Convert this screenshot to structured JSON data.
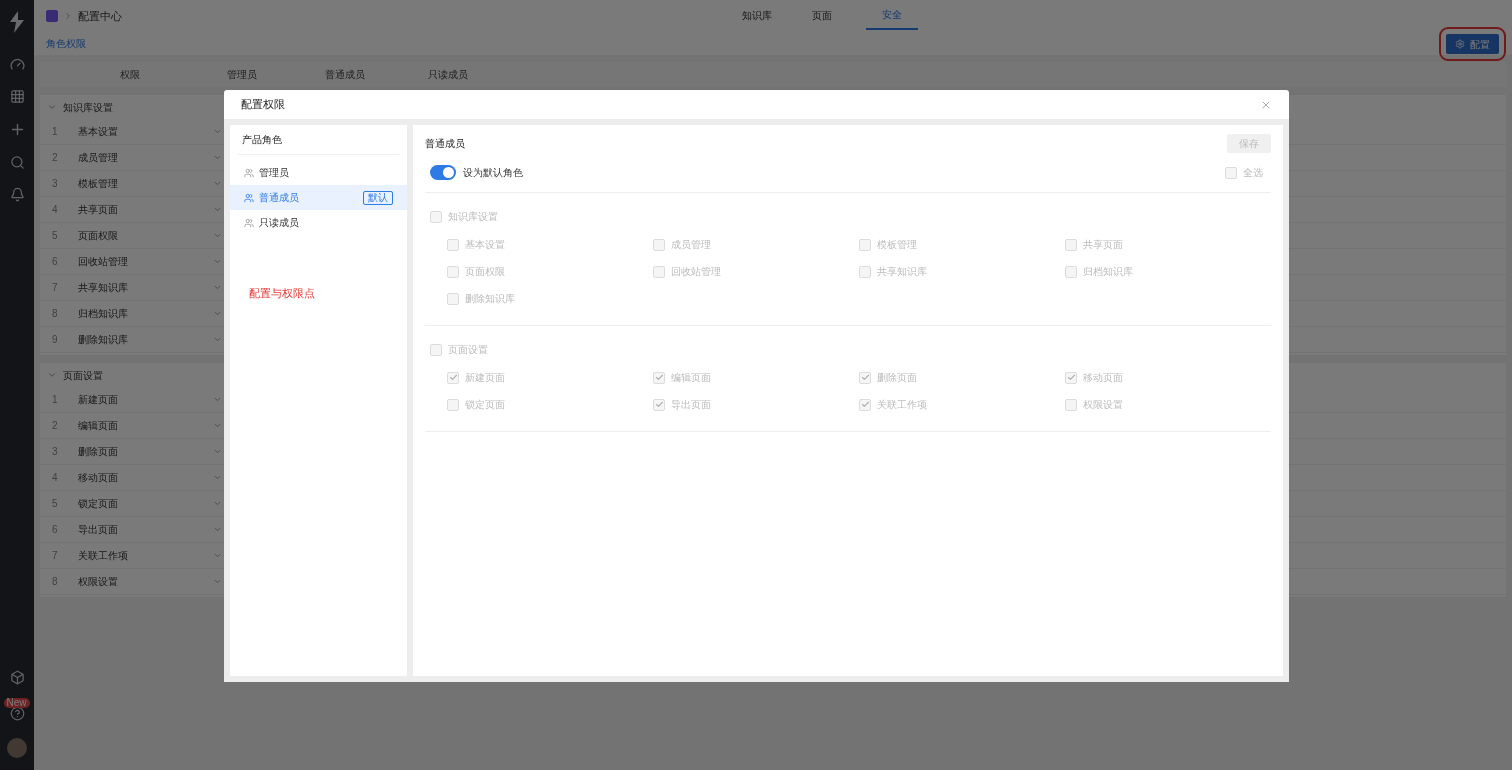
{
  "header": {
    "breadcrumb": "配置中心",
    "tabs": [
      {
        "label": "知识库",
        "selected": false
      },
      {
        "label": "页面",
        "selected": false
      },
      {
        "label": "安全",
        "selected": true
      }
    ],
    "sub_tab": "角色权限",
    "config_button": "配置"
  },
  "sidebar": {
    "badge": "New"
  },
  "table": {
    "columns": [
      "权限",
      "管理员",
      "普通成员",
      "只读成员"
    ],
    "groups": [
      {
        "title": "知识库设置",
        "expanded": true,
        "rows": [
          {
            "index": "1",
            "name": "基本设置"
          },
          {
            "index": "2",
            "name": "成员管理"
          },
          {
            "index": "3",
            "name": "模板管理"
          },
          {
            "index": "4",
            "name": "共享页面"
          },
          {
            "index": "5",
            "name": "页面权限"
          },
          {
            "index": "6",
            "name": "回收站管理"
          },
          {
            "index": "7",
            "name": "共享知识库"
          },
          {
            "index": "8",
            "name": "归档知识库"
          },
          {
            "index": "9",
            "name": "删除知识库"
          }
        ]
      },
      {
        "title": "页面设置",
        "expanded": true,
        "rows": [
          {
            "index": "1",
            "name": "新建页面"
          },
          {
            "index": "2",
            "name": "编辑页面"
          },
          {
            "index": "3",
            "name": "删除页面"
          },
          {
            "index": "4",
            "name": "移动页面"
          },
          {
            "index": "5",
            "name": "锁定页面"
          },
          {
            "index": "6",
            "name": "导出页面"
          },
          {
            "index": "7",
            "name": "关联工作项"
          },
          {
            "index": "8",
            "name": "权限设置"
          }
        ]
      }
    ]
  },
  "dialog": {
    "title": "配置权限",
    "roles_title": "产品角色",
    "roles": [
      {
        "name": "管理员",
        "selected": false
      },
      {
        "name": "普通成员",
        "selected": true,
        "badge": "默认"
      },
      {
        "name": "只读成员",
        "selected": false
      }
    ],
    "annotation": "配置与权限点",
    "role_name": "普通成员",
    "save_button": {
      "label": "保存",
      "disabled": true
    },
    "default_toggle": {
      "label": "设为默认角色",
      "on": true
    },
    "select_all": {
      "label": "全选",
      "checked": false,
      "disabled": true
    },
    "sections": [
      {
        "title": "知识库设置",
        "checked": false,
        "disabled": true,
        "items": [
          {
            "label": "基本设置",
            "checked": false
          },
          {
            "label": "成员管理",
            "checked": false
          },
          {
            "label": "模板管理",
            "checked": false
          },
          {
            "label": "共享页面",
            "checked": false
          },
          {
            "label": "页面权限",
            "checked": false
          },
          {
            "label": "回收站管理",
            "checked": false
          },
          {
            "label": "共享知识库",
            "checked": false
          },
          {
            "label": "归档知识库",
            "checked": false
          },
          {
            "label": "删除知识库",
            "checked": false
          }
        ]
      },
      {
        "title": "页面设置",
        "checked": false,
        "disabled": true,
        "items": [
          {
            "label": "新建页面",
            "checked": true
          },
          {
            "label": "编辑页面",
            "checked": true
          },
          {
            "label": "删除页面",
            "checked": true
          },
          {
            "label": "移动页面",
            "checked": true
          },
          {
            "label": "锁定页面",
            "checked": false
          },
          {
            "label": "导出页面",
            "checked": true
          },
          {
            "label": "关联工作项",
            "checked": true
          },
          {
            "label": "权限设置",
            "checked": false
          }
        ]
      }
    ]
  }
}
